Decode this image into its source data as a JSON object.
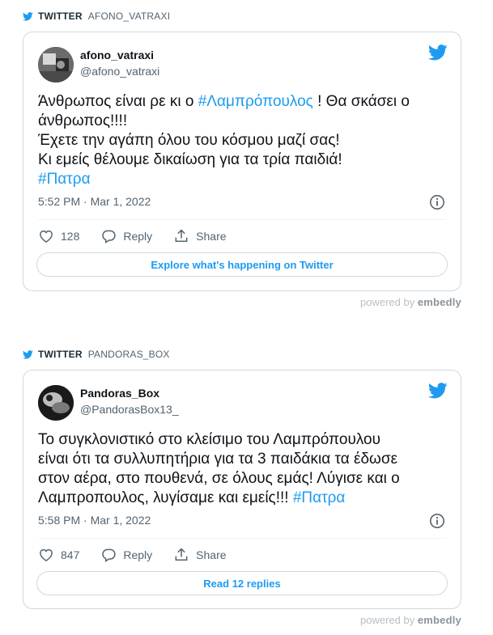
{
  "embeds": [
    {
      "header": {
        "source": "TWITTER",
        "user": "AFONO_VATRAXI"
      },
      "tweet": {
        "name": "afono_vatraxi",
        "handle": "@afono_vatraxi",
        "text_lines": [
          [
            "Άνθρωπος είναι ρε κι ο ",
            {
              "tag": "#Λαμπρόπουλος"
            },
            " ! Θα σκάσει ο"
          ],
          [
            "άνθρωπος!!!!"
          ],
          [
            "Έχετε την αγάπη όλου του κόσμου μαζί σας!"
          ],
          [
            "Κι εμείς θέλουμε δικαίωση για τα τρία παιδιά!"
          ],
          [
            {
              "tag": "#Πατρα"
            }
          ]
        ],
        "timestamp": "5:52 PM · Mar 1, 2022",
        "likes": "128",
        "reply_label": "Reply",
        "share_label": "Share",
        "cta_label": "Explore what's happening on Twitter"
      },
      "powered": {
        "prefix": "powered by",
        "brand": "embedly"
      }
    },
    {
      "header": {
        "source": "TWITTER",
        "user": "PANDORAS_BOX"
      },
      "tweet": {
        "name": "Pandoras_Box",
        "handle": "@PandorasBox13_",
        "text_lines": [
          [
            "Το συγκλονιστικό στο κλείσιμο του Λαμπρόπουλου"
          ],
          [
            "είναι ότι τα συλλυπητήρια για τα 3 παιδάκια τα έδωσε"
          ],
          [
            "στον αέρα, στο πουθενά, σε όλους εμάς! Λύγισε και ο"
          ],
          [
            "Λαμπροπουλος, λυγίσαμε και εμείς!!! ",
            {
              "tag": "#Πατρα"
            }
          ]
        ],
        "timestamp": "5:58 PM · Mar 1, 2022",
        "likes": "847",
        "reply_label": "Reply",
        "share_label": "Share",
        "cta_label": "Read 12 replies"
      },
      "powered": {
        "prefix": "powered by",
        "brand": "embedly"
      }
    }
  ],
  "colors": {
    "accent": "#1d9bf0",
    "muted": "#536471",
    "border": "#cfd9de"
  },
  "icons": [
    "twitter-bird-icon",
    "info-icon",
    "heart-icon",
    "reply-icon",
    "share-icon"
  ]
}
